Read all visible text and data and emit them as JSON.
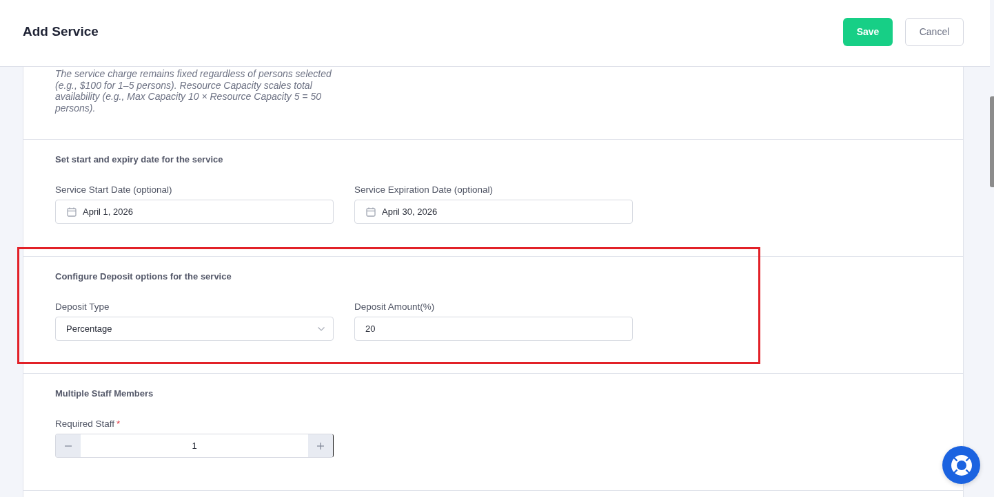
{
  "header": {
    "title": "Add Service",
    "buttons": [
      {
        "label": "Save",
        "kind": "primary"
      },
      {
        "label": "Cancel",
        "kind": "secondary"
      }
    ]
  },
  "note": "The service charge remains fixed regardless of persons selected (e.g., $100 for 1–5 persons). Resource Capacity scales total availability (e.g., Max Capacity 10 × Resource Capacity 5 = 50 persons).",
  "sections": [
    {
      "heading": "Set start and expiry date for the service",
      "highlighted": false,
      "fields": [
        {
          "kind": "date",
          "label": "Service Start Date (optional)",
          "value": "April 1, 2026"
        },
        {
          "kind": "date",
          "label": "Service Expiration Date (optional)",
          "value": "April 30, 2026"
        }
      ]
    },
    {
      "heading": "Configure Deposit options for the service",
      "highlighted": true,
      "fields": [
        {
          "kind": "select",
          "label": "Deposit Type",
          "value": "Percentage"
        },
        {
          "kind": "text",
          "label": "Deposit Amount(%)",
          "value": "20"
        }
      ]
    },
    {
      "heading": "Multiple Staff Members",
      "highlighted": false,
      "fields": [
        {
          "kind": "stepper",
          "label": "Required Staff",
          "required_mark": "*",
          "value": "1"
        }
      ]
    }
  ]
}
